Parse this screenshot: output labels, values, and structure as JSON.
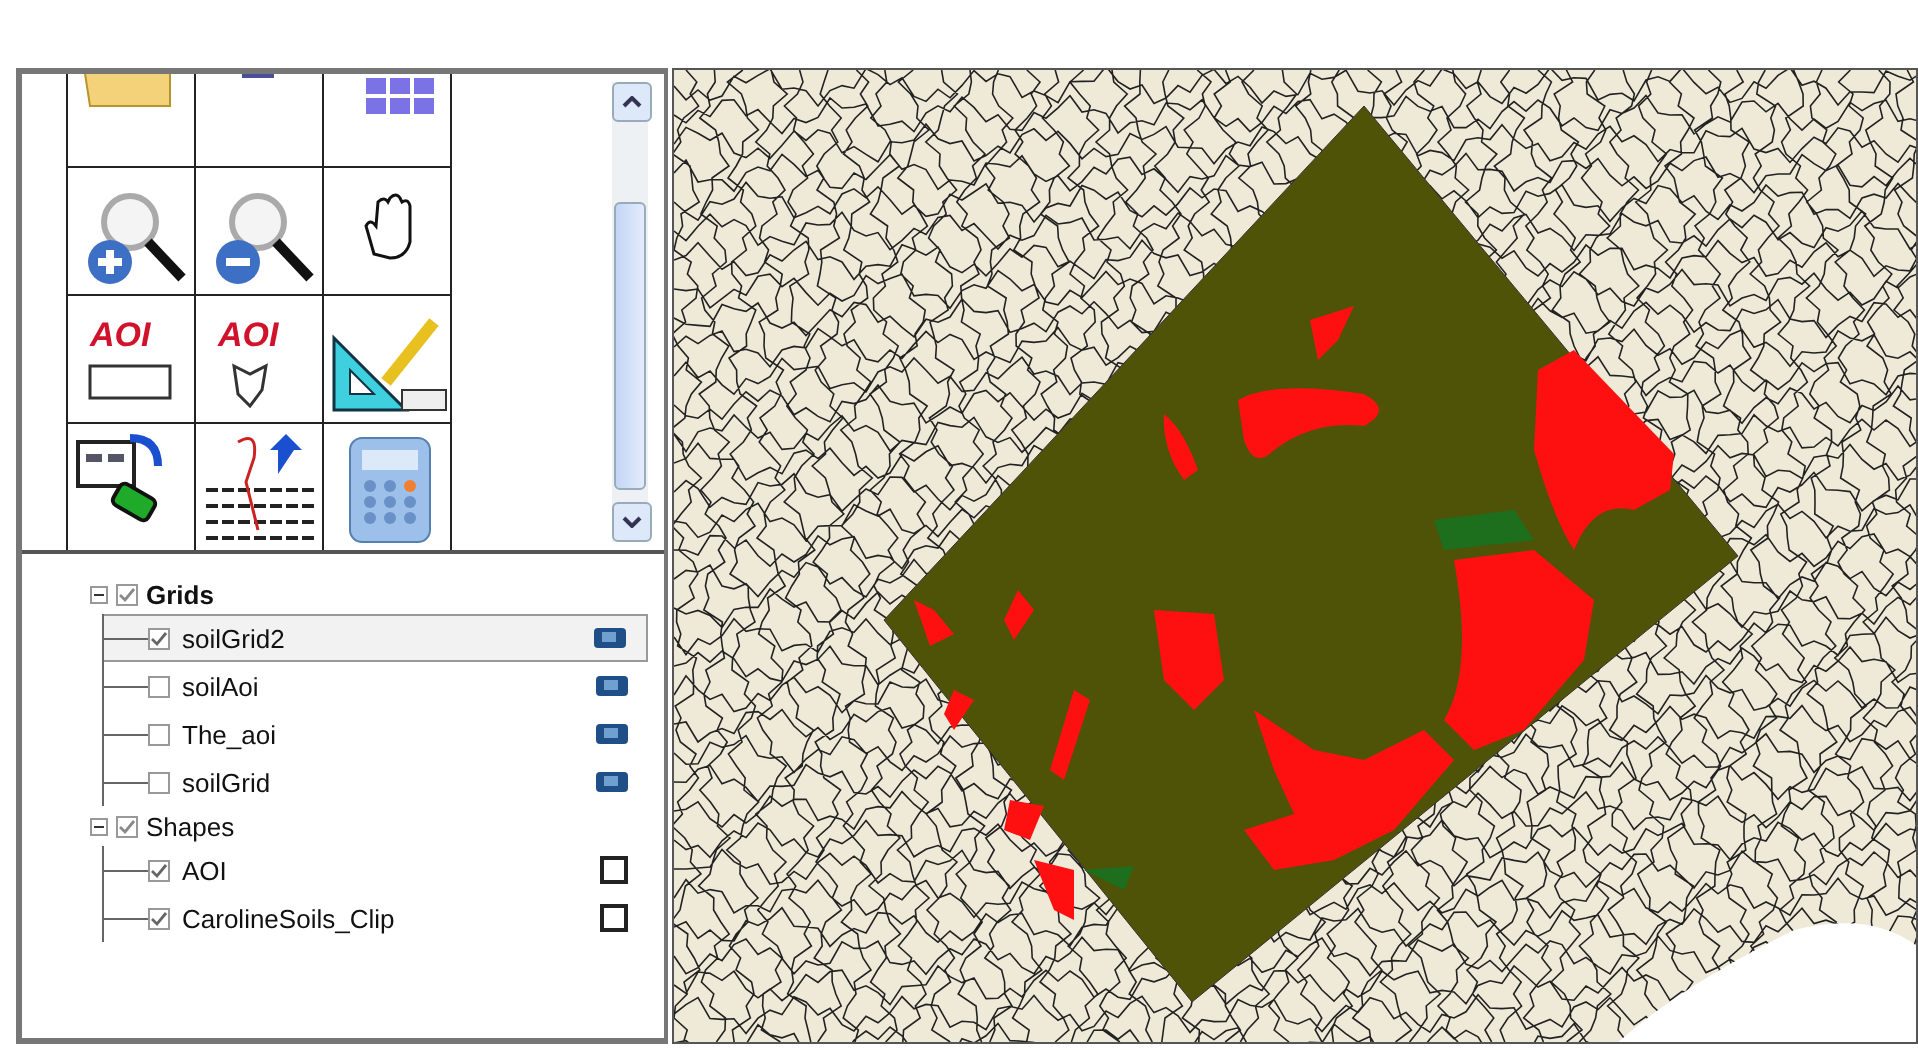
{
  "toolbar": {
    "tools": [
      {
        "kind": "folder"
      },
      {
        "kind": "save"
      },
      {
        "kind": "grid"
      },
      {
        "kind": "zoom-in"
      },
      {
        "kind": "zoom-out"
      },
      {
        "kind": "pan"
      },
      {
        "kind": "aoi-rect",
        "label": "AOI"
      },
      {
        "kind": "aoi-poly",
        "label": "AOI"
      },
      {
        "kind": "measure"
      },
      {
        "kind": "export"
      },
      {
        "kind": "profile"
      },
      {
        "kind": "calculator"
      }
    ]
  },
  "layers": [
    {
      "name": "Grids",
      "checked": true,
      "expanded": true,
      "active": true,
      "children": [
        {
          "name": "soilGrid2",
          "checked": true,
          "selected": true,
          "kind": "grid"
        },
        {
          "name": "soilAoi",
          "checked": false,
          "selected": false,
          "kind": "grid"
        },
        {
          "name": "The_aoi",
          "checked": false,
          "selected": false,
          "kind": "grid"
        },
        {
          "name": "soilGrid",
          "checked": false,
          "selected": false,
          "kind": "grid"
        }
      ]
    },
    {
      "name": "Shapes",
      "checked": true,
      "expanded": true,
      "active": false,
      "children": [
        {
          "name": "AOI",
          "checked": true,
          "selected": false,
          "kind": "shape"
        },
        {
          "name": "CarolineSoils_Clip",
          "checked": true,
          "selected": false,
          "kind": "shape"
        }
      ]
    }
  ]
}
